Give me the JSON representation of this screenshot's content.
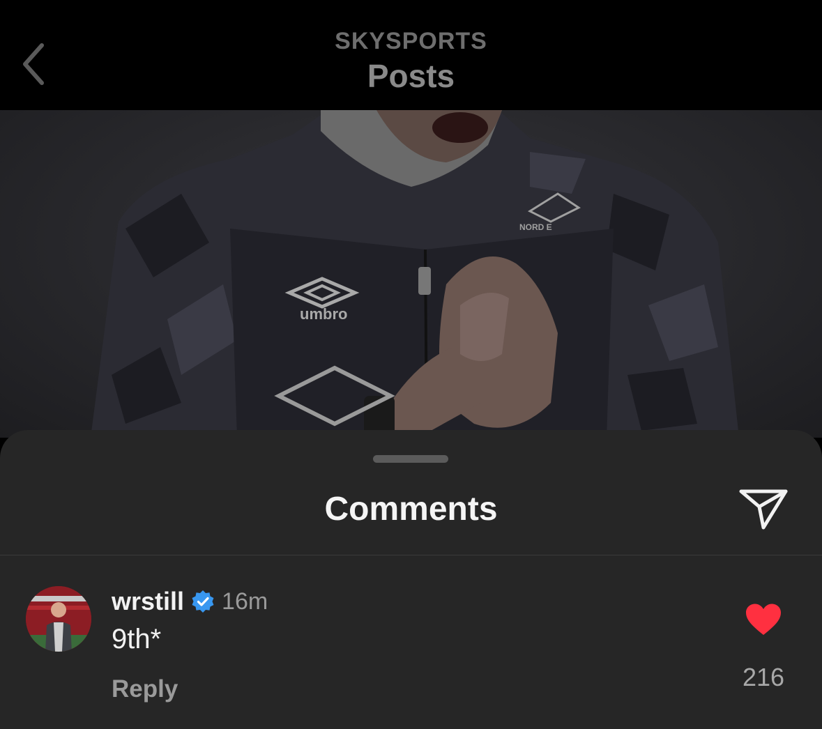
{
  "header": {
    "account": "SKYSPORTS",
    "title": "Posts",
    "back_icon": "chevron-left-icon"
  },
  "photo": {
    "brand_logo_text": "umbro",
    "sponsor_text": "NORD E"
  },
  "comments_sheet": {
    "title": "Comments",
    "share_icon": "paper-plane-icon"
  },
  "comments": [
    {
      "username": "wrstill",
      "verified": true,
      "time": "16m",
      "text": "9th*",
      "reply_label": "Reply",
      "liked": true,
      "like_count": "216"
    }
  ],
  "colors": {
    "like_red": "#ff3040",
    "verified_blue": "#3897f0",
    "sheet_bg": "#262626"
  }
}
